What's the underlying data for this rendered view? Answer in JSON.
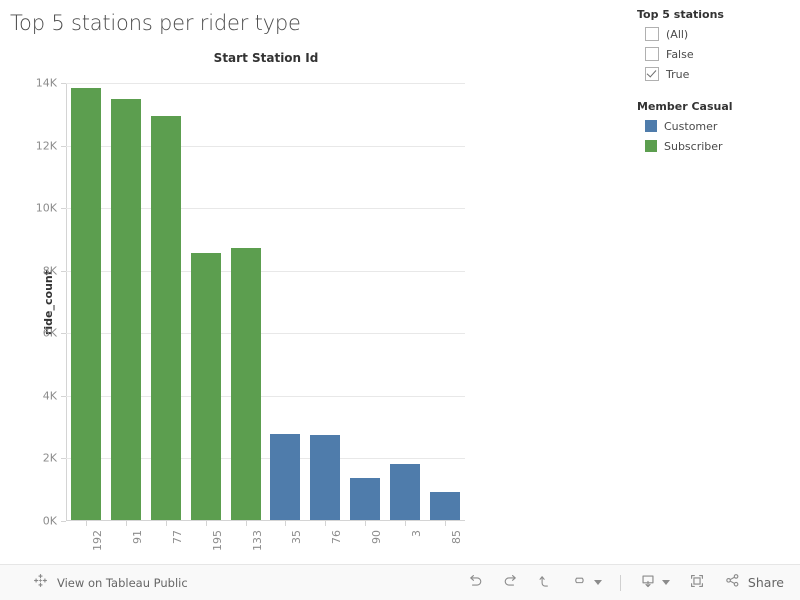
{
  "title": "Top 5 stations per rider type",
  "chart_data": {
    "type": "bar",
    "title": "Top 5 stations per rider type",
    "column_header": "Start Station Id",
    "xlabel": "Start Station Id",
    "ylabel": "ride_count",
    "ylim": [
      0,
      14000
    ],
    "grid": true,
    "y_ticks": [
      {
        "label": "14K",
        "value": 14000
      },
      {
        "label": "12K",
        "value": 12000
      },
      {
        "label": "10K",
        "value": 10000
      },
      {
        "label": "8K",
        "value": 8000
      },
      {
        "label": "6K",
        "value": 6000
      },
      {
        "label": "4K",
        "value": 4000
      },
      {
        "label": "2K",
        "value": 2000
      },
      {
        "label": "0K",
        "value": 0
      }
    ],
    "categories": [
      "192",
      "91",
      "77",
      "195",
      "133",
      "35",
      "76",
      "90",
      "3",
      "85"
    ],
    "values": [
      13800,
      13450,
      12900,
      8550,
      8700,
      2750,
      2720,
      1350,
      1800,
      900
    ],
    "colors": [
      "#5C9E4F",
      "#5C9E4F",
      "#5C9E4F",
      "#5C9E4F",
      "#5C9E4F",
      "#4F7CAB",
      "#4F7CAB",
      "#4F7CAB",
      "#4F7CAB",
      "#4F7CAB"
    ],
    "series": [
      {
        "name": "Subscriber",
        "color": "#5C9E4F",
        "categories": [
          "192",
          "91",
          "77",
          "195",
          "133"
        ],
        "values": [
          13800,
          13450,
          12900,
          8550,
          8700
        ]
      },
      {
        "name": "Customer",
        "color": "#4F7CAB",
        "categories": [
          "35",
          "76",
          "90",
          "3",
          "85"
        ],
        "values": [
          2750,
          2720,
          1350,
          1800,
          900
        ]
      }
    ],
    "legend_position": "right"
  },
  "filter": {
    "title": "Top 5 stations",
    "items": [
      {
        "label": "(All)",
        "checked": false
      },
      {
        "label": "False",
        "checked": false
      },
      {
        "label": "True",
        "checked": true
      }
    ]
  },
  "legend": {
    "title": "Member Casual",
    "items": [
      {
        "label": "Customer",
        "color": "#4F7CAB"
      },
      {
        "label": "Subscriber",
        "color": "#5C9E4F"
      }
    ]
  },
  "toolbar": {
    "tableau_public_label": "View on Tableau Public",
    "tableau_logo_icon": "tableau-logo-icon",
    "undo_icon": "undo-icon",
    "redo_icon": "redo-icon",
    "revert_icon": "revert-icon",
    "refresh_icon": "refresh-icon",
    "download_icon": "download-icon",
    "fullscreen_icon": "fullscreen-icon",
    "share_icon": "share-icon",
    "share_label": "Share"
  }
}
